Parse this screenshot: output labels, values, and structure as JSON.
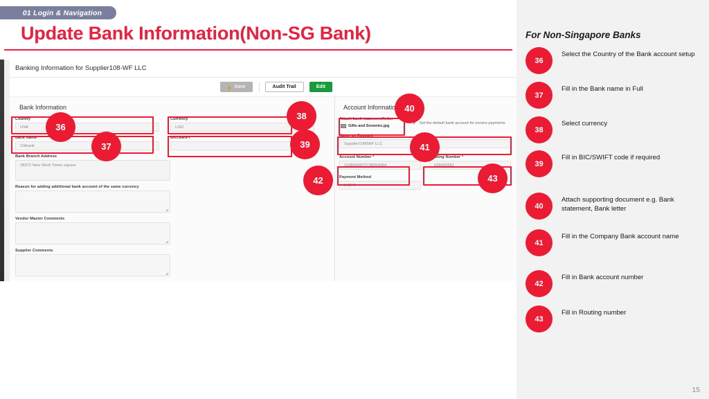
{
  "slide": {
    "section_tab": "01 Login & Navigation",
    "title": "Update Bank Information(Non-SG Bank)",
    "page_number": "15",
    "accent_color": "#ea1b33",
    "tab_color": "#7b7f9e"
  },
  "screenshot": {
    "header_title": "Banking Information for Supplier108-WF LLC",
    "toolbar": {
      "save_label": "Save",
      "save_icon": "lock-icon",
      "audit_label": "Audit Trail",
      "edit_label": "Edit",
      "edit_color": "#1a9a3c"
    },
    "bank_information": {
      "section_title": "Bank Information",
      "fields": [
        {
          "label": "Country",
          "value": "USA"
        },
        {
          "label": "Currency",
          "value": "USD"
        },
        {
          "label": "Bank Name",
          "value": "Citibank"
        },
        {
          "label": "BIC/SWIFT",
          "value": ""
        },
        {
          "label": "Bank Branch Address",
          "value": "28372 New Work Times square"
        },
        {
          "label": "Reason for adding additional bank account of the same currency",
          "value": ""
        },
        {
          "label": "Vendor Master Comments",
          "value": ""
        },
        {
          "label": "Supplier Comments",
          "value": ""
        }
      ]
    },
    "account_information": {
      "section_title": "Account Information",
      "attach_label": "Attach bank statement/letter",
      "attach_file": "Gifts and Sovenirs.jpg",
      "attach_file_icon": "file-icon",
      "default_account_check": "✓",
      "default_account_label": "Set the default bank account for invoice payments",
      "fields": [
        {
          "label": "Name on Account",
          "value": "Supplier1080WF LLC"
        },
        {
          "label": "Account Number *",
          "value": "1038943972738254054"
        },
        {
          "label": "Routing Number *",
          "value": "026002561"
        },
        {
          "label": "Payment Method",
          "value": "1-EFT"
        }
      ]
    },
    "callouts": [
      "36",
      "37",
      "38",
      "39",
      "40",
      "41",
      "42",
      "43"
    ]
  },
  "instructions": {
    "heading": "For Non-Singapore Banks",
    "steps": [
      {
        "number": "36",
        "text": "Select the Country of the Bank account setup"
      },
      {
        "number": "37",
        "text": " Fill in the Bank name in Full"
      },
      {
        "number": "38",
        "text": "Select currency"
      },
      {
        "number": "39",
        "text": "Fill in BIC/SWIFT code if required"
      },
      {
        "number": "40",
        "text": "Attach supporting document e.g. Bank statement, Bank letter"
      },
      {
        "number": "41",
        "text": "Fill in the Company Bank account name"
      },
      {
        "number": "42",
        "text": "Fill in Bank account number"
      },
      {
        "number": "43",
        "text": "Fill in Routing number"
      }
    ]
  }
}
